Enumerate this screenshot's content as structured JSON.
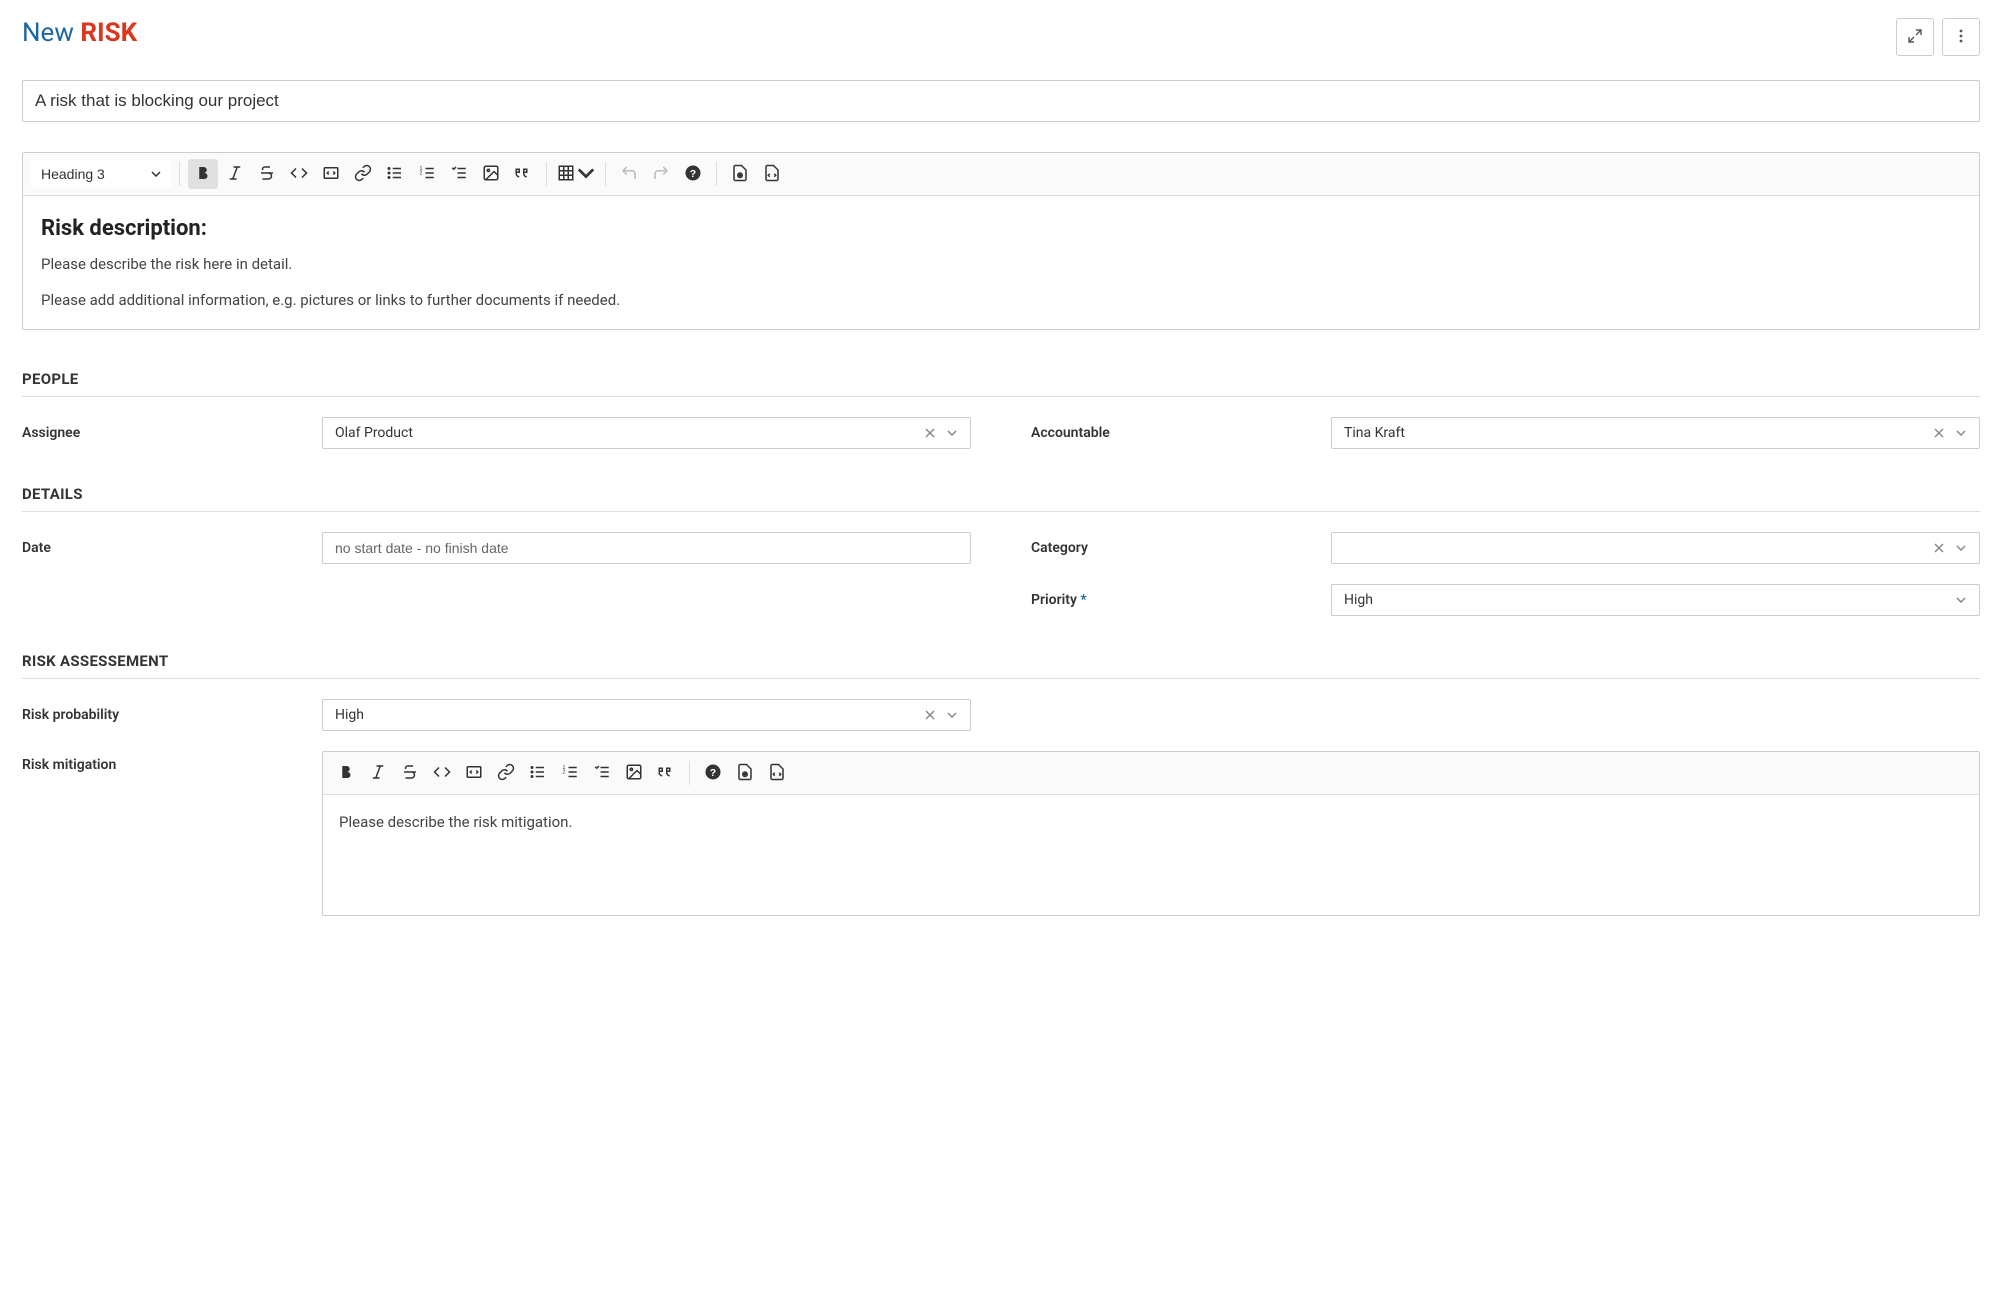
{
  "header": {
    "title_new": "New",
    "title_type": "RISK"
  },
  "title_input": {
    "value": "A risk that is blocking our project"
  },
  "toolbar_main": {
    "heading_select": "Heading 3"
  },
  "description": {
    "heading": "Risk description:",
    "line1": "Please describe the risk here in detail.",
    "line2": "Please add additional information, e.g. pictures or links to further documents if needed."
  },
  "sections": {
    "people": "PEOPLE",
    "details": "DETAILS",
    "risk_assessment": "RISK ASSESSEMENT"
  },
  "fields": {
    "assignee": {
      "label": "Assignee",
      "value": "Olaf Product"
    },
    "accountable": {
      "label": "Accountable",
      "value": "Tina Kraft"
    },
    "date": {
      "label": "Date",
      "value": "no start date - no finish date"
    },
    "category": {
      "label": "Category",
      "value": ""
    },
    "priority": {
      "label": "Priority",
      "value": "High",
      "required": "*"
    },
    "risk_probability": {
      "label": "Risk probability",
      "value": "High"
    },
    "risk_mitigation": {
      "label": "Risk mitigation",
      "content": "Please describe the risk mitigation."
    }
  }
}
